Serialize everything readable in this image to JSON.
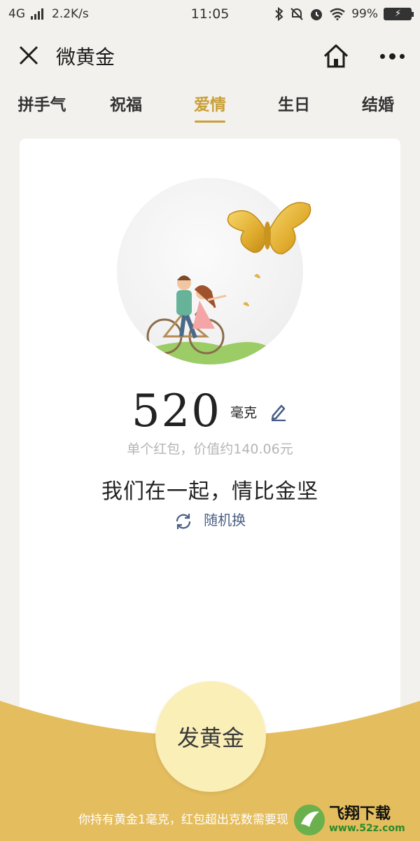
{
  "status_bar": {
    "network": "4G",
    "speed": "2.2K/s",
    "time": "11:05",
    "battery": "99%"
  },
  "nav": {
    "title": "微黄金"
  },
  "tabs": [
    {
      "label": "拼手气",
      "active": false
    },
    {
      "label": "祝福",
      "active": false
    },
    {
      "label": "爱情",
      "active": true
    },
    {
      "label": "生日",
      "active": false
    },
    {
      "label": "结婚",
      "active": false
    }
  ],
  "gift": {
    "amount": "520",
    "unit": "毫克",
    "value_text": "单个红包，价值约140.06元",
    "blessing": "我们在一起，情比金坚",
    "shuffle_label": "随机换"
  },
  "send": {
    "label": "发黄金"
  },
  "footer": {
    "text": "你持有黄金1毫克，红包超出克数需要现"
  },
  "watermark": {
    "title": "飞翔下载",
    "url": "www.52z.com"
  },
  "colors": {
    "accent_gold": "#c9a03a",
    "bottom_gold": "#e4bd5e",
    "send_button": "#fbefb8",
    "link_blue": "#4a5f85"
  }
}
